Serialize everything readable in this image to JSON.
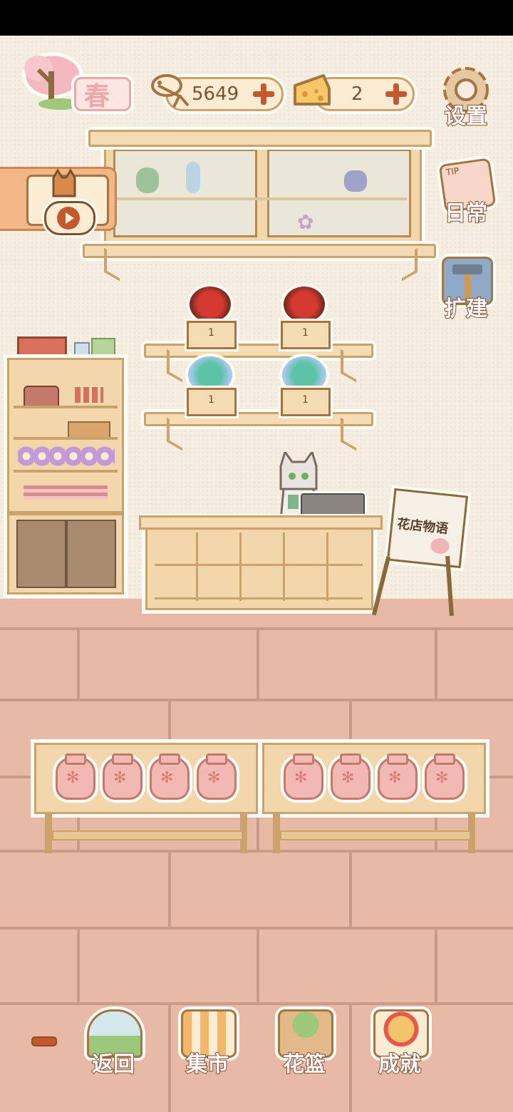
{
  "season": {
    "label": "春"
  },
  "currency": {
    "fish_value": "5649",
    "cheese_value": "2"
  },
  "side_menu": {
    "settings": "设置",
    "daily": "日常",
    "expand": "扩建"
  },
  "daily_icon_tip": "TIP",
  "easel_sign": "花店物语",
  "shelf_crates": [
    "1",
    "1",
    "1",
    "1"
  ],
  "bottom_nav": {
    "back": "返回",
    "market": "集市",
    "flower_basket": "花篮",
    "achievements": "成就"
  },
  "colors": {
    "wall": "#f4ede0",
    "floor": "#e8b9a4",
    "wood": "#f1d7ab",
    "accent_orange": "#c4582e",
    "label_outline": "#8a4b2e"
  },
  "icons": [
    "blossom-tree-icon",
    "fish-bone-icon",
    "cheese-icon",
    "plus-icon",
    "gear-icon",
    "tip-notes-icon",
    "hammer-icon",
    "play-icon",
    "cat-icon",
    "window-icon",
    "market-stall-icon",
    "basket-icon",
    "trophy-icon",
    "minus-icon"
  ]
}
